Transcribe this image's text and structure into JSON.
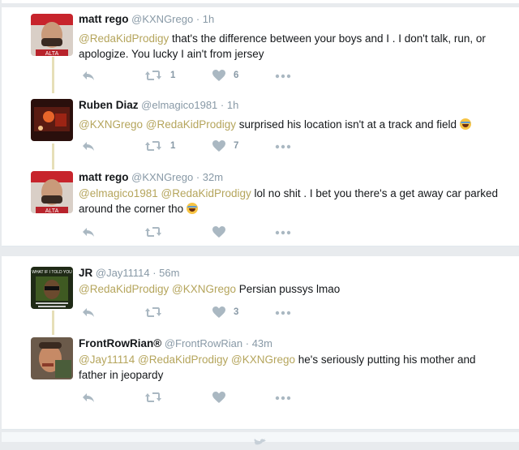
{
  "tweets": [
    {
      "name": "matt rego",
      "handle": "@KXNGrego",
      "time": "1h",
      "text": [
        {
          "t": "@RedaKidProdigy",
          "m": true
        },
        {
          "t": " that's the difference between your boys and I . I don't talk, run, or apologize. You lucky I ain't from jersey",
          "m": false
        }
      ],
      "retweets": "1",
      "likes": "6",
      "avatar": "matt-rego-avatar"
    },
    {
      "name": "Ruben Diaz",
      "handle": "@elmagico1981",
      "time": "1h",
      "text": [
        {
          "t": "@KXNGrego",
          "m": true
        },
        {
          "t": " ",
          "m": false
        },
        {
          "t": "@RedaKidProdigy",
          "m": true
        },
        {
          "t": " surprised his location isn't at a track and field ",
          "m": false
        },
        {
          "t": "",
          "e": true
        }
      ],
      "retweets": "1",
      "likes": "7",
      "avatar": "ruben-diaz-avatar"
    },
    {
      "name": "matt rego",
      "handle": "@KXNGrego",
      "time": "32m",
      "text": [
        {
          "t": "@elmagico1981",
          "m": true
        },
        {
          "t": " ",
          "m": false
        },
        {
          "t": "@RedaKidProdigy",
          "m": true
        },
        {
          "t": " lol no shit . I bet you there's a get away car parked around the corner tho ",
          "m": false
        },
        {
          "t": "",
          "e": true
        }
      ],
      "retweets": "",
      "likes": "",
      "avatar": "matt-rego-avatar"
    },
    {
      "name": "JR",
      "handle": "@Jay11114",
      "time": "56m",
      "text": [
        {
          "t": "@RedaKidProdigy",
          "m": true
        },
        {
          "t": " ",
          "m": false
        },
        {
          "t": "@KXNGrego",
          "m": true
        },
        {
          "t": " Persian pussys lmao",
          "m": false
        }
      ],
      "retweets": "",
      "likes": "3",
      "avatar": "jr-avatar"
    },
    {
      "name": "FrontRowRian®",
      "handle": "@FrontRowRian",
      "time": "43m",
      "text": [
        {
          "t": "@Jay11114",
          "m": true
        },
        {
          "t": " ",
          "m": false
        },
        {
          "t": "@RedaKidProdigy",
          "m": true
        },
        {
          "t": " ",
          "m": false
        },
        {
          "t": "@KXNGrego",
          "m": true
        },
        {
          "t": " he's seriously putting his mother and father in jeopardy",
          "m": false
        }
      ],
      "retweets": "",
      "likes": "",
      "avatar": "frontrowrian-avatar"
    }
  ],
  "avatar_text": {
    "jr": "WHAT IF I TOLD YOU"
  },
  "colors": {
    "mention": "#b5a55c",
    "thread_line": "#e6dfb8",
    "icon": "#aab8c2",
    "muted": "#8899a6"
  }
}
